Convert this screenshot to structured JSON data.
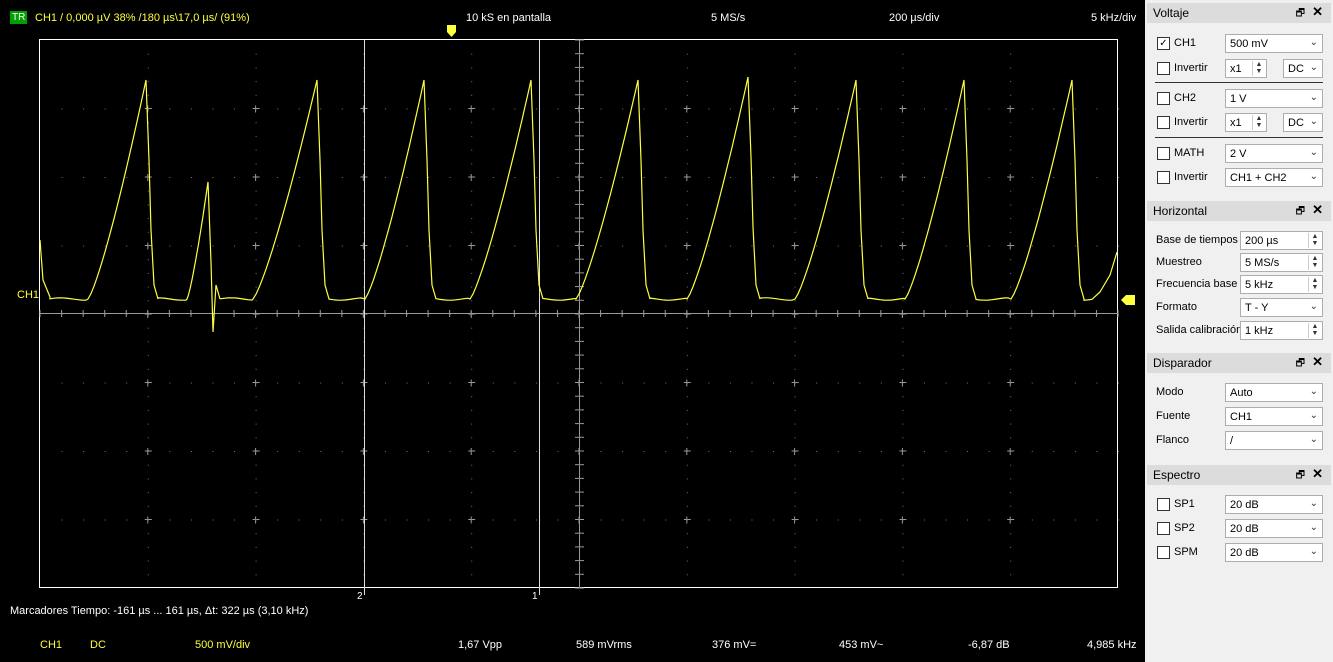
{
  "top": {
    "trigger_badge": "TR",
    "channel_info": "CH1  /  0,000 µV  38%  /180 µs\\17,0 µs/ (91%)",
    "samples": "10 kS en pantalla",
    "samplerate": "5 MS/s",
    "timebase": "200 µs/div",
    "freqbase": "5 kHz/div"
  },
  "plot": {
    "ch1_label": "CH1",
    "marker2": "2",
    "marker1": "1",
    "trace_color": "#ffff40"
  },
  "markers_text": "Marcadores  Tiempo: -161 µs ... 161 µs,  Δt: 322 µs (3,10 kHz)",
  "measurements": {
    "channel": "CH1",
    "coupling": "DC",
    "scale": "500 mV/div",
    "vpp": "1,67 Vpp",
    "vrms": "589 mVrms",
    "vdc": "376 mV=",
    "vac": "453 mV~",
    "db": "-6,87 dB",
    "freq": "4,985 kHz"
  },
  "voltage": {
    "title": "Voltaje",
    "ch1": {
      "label": "CH1",
      "checked": true,
      "value": "500 mV"
    },
    "inv1": {
      "label": "Invertir",
      "probe": "x1",
      "coupling": "DC"
    },
    "ch2": {
      "label": "CH2",
      "value": "1 V"
    },
    "inv2": {
      "label": "Invertir",
      "probe": "x1",
      "coupling": "DC"
    },
    "math": {
      "label": "MATH",
      "value": "2 V"
    },
    "inv3": {
      "label": "Invertir",
      "value": "CH1 + CH2"
    }
  },
  "horizontal": {
    "title": "Horizontal",
    "rows": [
      {
        "label": "Base de tiempos",
        "value": "200 µs"
      },
      {
        "label": "Muestreo",
        "value": "5 MS/s"
      },
      {
        "label": "Frecuencia base",
        "value": "5 kHz"
      },
      {
        "label": "Formato",
        "value": "T - Y"
      },
      {
        "label": "Salida calibración",
        "value": "1 kHz"
      }
    ]
  },
  "trigger": {
    "title": "Disparador",
    "rows": [
      {
        "label": "Modo",
        "value": "Auto"
      },
      {
        "label": "Fuente",
        "value": "CH1"
      },
      {
        "label": "Flanco",
        "value": "/"
      }
    ]
  },
  "spectrum": {
    "title": "Espectro",
    "rows": [
      {
        "label": "SP1",
        "value": "20 dB"
      },
      {
        "label": "SP2",
        "value": "20 dB"
      },
      {
        "label": "SPM",
        "value": "20 dB"
      }
    ]
  }
}
